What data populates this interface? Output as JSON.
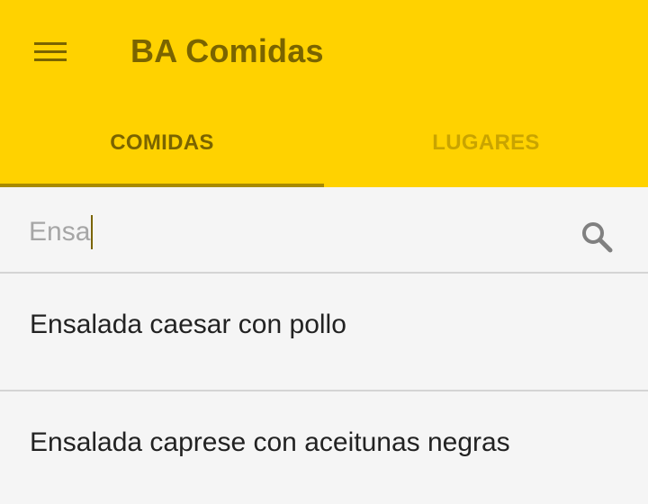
{
  "app": {
    "title": "BA Comidas",
    "accent_color": "#ffd200",
    "title_color": "#7a6400"
  },
  "toolbar": {
    "menu_icon": "hamburger-menu-icon"
  },
  "tabs": [
    {
      "label": "COMIDAS",
      "active": true
    },
    {
      "label": "LUGARES",
      "active": false
    }
  ],
  "search": {
    "value": "Ensa",
    "icon": "search-icon"
  },
  "results": [
    {
      "label": "Ensalada caesar con pollo"
    },
    {
      "label": "Ensalada caprese con aceitunas negras"
    }
  ]
}
